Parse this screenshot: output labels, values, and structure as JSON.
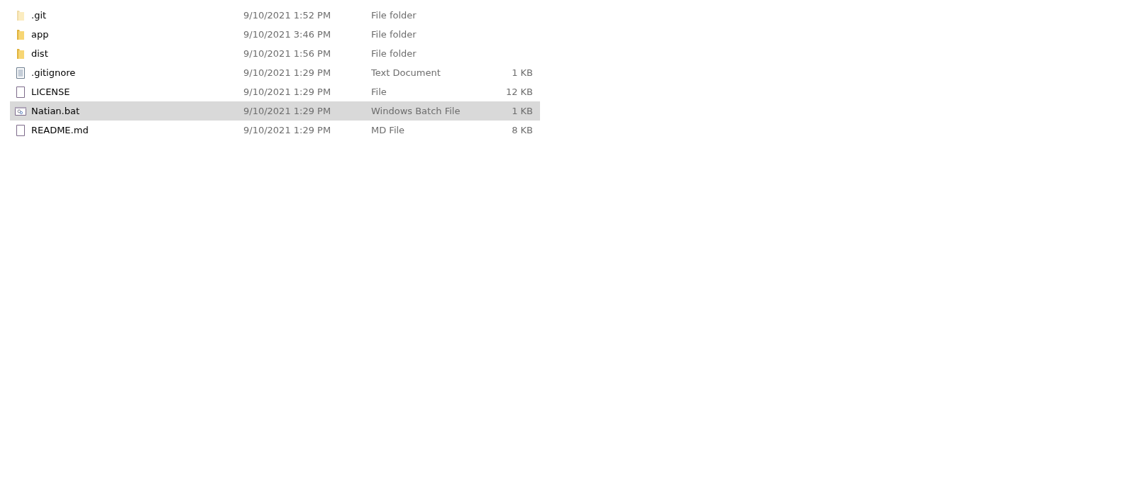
{
  "files": [
    {
      "name": ".git",
      "modified": "9/10/2021 1:52 PM",
      "type": "File folder",
      "kind": "folder",
      "hidden": true,
      "selected": false
    },
    {
      "name": "app",
      "modified": "9/10/2021 3:46 PM",
      "type": "File folder",
      "kind": "folder",
      "hidden": false,
      "selected": false
    },
    {
      "name": "dist",
      "modified": "9/10/2021 1:56 PM",
      "type": "File folder",
      "kind": "folder",
      "hidden": false,
      "selected": false
    },
    {
      "name": ".gitignore",
      "modified": "9/10/2021 1:29 PM",
      "type": "Text Document",
      "size": "1 KB",
      "kind": "text",
      "hidden": false,
      "selected": false
    },
    {
      "name": "LICENSE",
      "modified": "9/10/2021 1:29 PM",
      "type": "File",
      "size": "12 KB",
      "kind": "file",
      "hidden": false,
      "selected": false
    },
    {
      "name": "Natian.bat",
      "modified": "9/10/2021 1:29 PM",
      "type": "Windows Batch File",
      "size": "1 KB",
      "kind": "batch",
      "hidden": false,
      "selected": true
    },
    {
      "name": "README.md",
      "modified": "9/10/2021 1:29 PM",
      "type": "MD File",
      "size": "8 KB",
      "kind": "file",
      "hidden": false,
      "selected": false
    }
  ]
}
